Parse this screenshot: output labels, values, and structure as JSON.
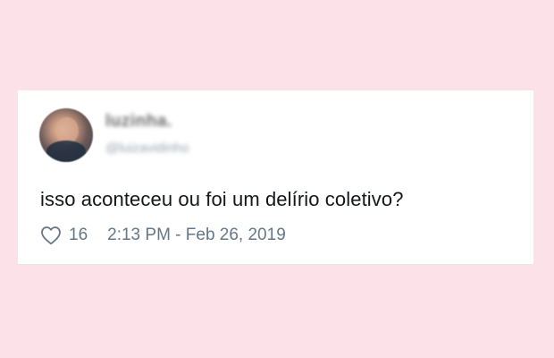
{
  "tweet": {
    "display_name": "luzinha.",
    "handle": "@luizavidinho",
    "text": "isso aconteceu ou foi um delírio coletivo?",
    "like_count": "16",
    "timestamp": "2:13 PM - Feb 26, 2019"
  },
  "colors": {
    "background": "#fce1e9",
    "card": "#ffffff",
    "text": "#14171a",
    "meta": "#657786"
  },
  "icons": {
    "like": "heart-outline-icon"
  }
}
